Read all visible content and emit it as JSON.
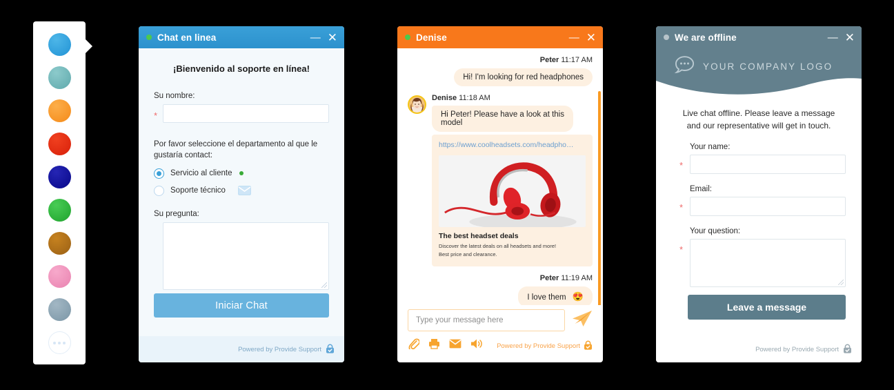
{
  "palette": {
    "name": "color-theme-palette",
    "swatches": [
      {
        "name": "blue",
        "color": "#2fa3dd"
      },
      {
        "name": "teal",
        "color": "#72b9bb"
      },
      {
        "name": "orange",
        "color": "#f99a29"
      },
      {
        "name": "red",
        "color": "#e32a12"
      },
      {
        "name": "navy",
        "color": "#13139e"
      },
      {
        "name": "green",
        "color": "#2eb83c"
      },
      {
        "name": "brown",
        "color": "#b0701c"
      },
      {
        "name": "pink",
        "color": "#f094bd"
      },
      {
        "name": "slate",
        "color": "#8ba4b3"
      }
    ],
    "more_label": "more-colors"
  },
  "window_prechat": {
    "title": "Chat en linea",
    "status_dot_color": "#4dc94d",
    "titlebar_color": "#2e97d4",
    "minimize_label": "—",
    "close_label": "✕",
    "welcome": "¡Bienvenido al soporte en línea!",
    "name_label": "Su nombre:",
    "name_value": "",
    "required_mark": "*",
    "department_prompt": "Por favor seleccione el departamento al que le gustaría contact:",
    "departments": [
      {
        "label": "Servicio al cliente",
        "selected": true,
        "indicator": "online-dot"
      },
      {
        "label": "Soporte técnico",
        "selected": false,
        "indicator": "mail-icon"
      }
    ],
    "question_label": "Su pregunta:",
    "question_value": "",
    "start_button": "Iniciar Chat",
    "footer_text": "Powered by Provide Support",
    "footer_icon": "lock-icon"
  },
  "window_chat": {
    "title": "Denise",
    "status_dot_color": "#4dc94d",
    "titlebar_color": "#f8781b",
    "minimize_label": "—",
    "close_label": "✕",
    "messages": [
      {
        "sender": "Peter",
        "time": "11:17 AM",
        "side": "right",
        "text": "Hi! I'm looking for red headphones"
      },
      {
        "sender": "Denise",
        "time": "11:18 AM",
        "side": "left",
        "avatar": "agent-photo",
        "text": "Hi Peter! Please have a look at this model",
        "card": {
          "url": "https://www.coolheadsets.com/headpho…",
          "image": "red-headphones-photo",
          "title": "The best headset deals",
          "description_line1": "Discover the latest deals on all headsets and more!",
          "description_line2": "Best price and clearance."
        }
      },
      {
        "sender": "Peter",
        "time": "11:19 AM",
        "side": "right",
        "text": "I love them",
        "emoji": "😍"
      }
    ],
    "compose_placeholder": "Type your message here",
    "compose_value": "",
    "send_icon": "send-paper-plane-icon",
    "toolbar_icons": [
      "attachment-icon",
      "print-icon",
      "email-icon",
      "sound-icon"
    ],
    "footer_text": "Powered by Provide Support",
    "footer_icon": "lock-icon"
  },
  "window_offline": {
    "title": "We are offline",
    "status_dot_color": "#b7c3c9",
    "titlebar_color": "#63808d",
    "minimize_label": "—",
    "close_label": "✕",
    "logo_text": "YOUR COMPANY LOGO",
    "logo_icon": "chat-bubble-icon",
    "intro_line1": "Live chat offline. Please leave a message",
    "intro_line2": "and our representative will get in touch.",
    "required_mark": "*",
    "name_label": "Your name:",
    "name_value": "",
    "email_label": "Email:",
    "email_value": "",
    "question_label": "Your question:",
    "question_value": "",
    "submit_button": "Leave a message",
    "footer_text": "Powered by Provide Support",
    "footer_icon": "lock-icon"
  }
}
